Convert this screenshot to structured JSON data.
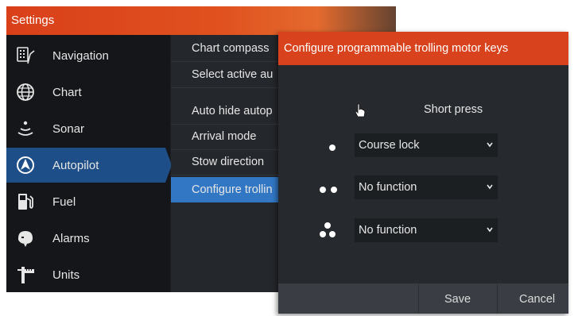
{
  "settings": {
    "title": "Settings",
    "nav": [
      {
        "icon": "navigation-icon",
        "label": "Navigation"
      },
      {
        "icon": "globe-icon",
        "label": "Chart"
      },
      {
        "icon": "sonar-icon",
        "label": "Sonar"
      },
      {
        "icon": "autopilot-icon",
        "label": "Autopilot",
        "active": true
      },
      {
        "icon": "fuel-icon",
        "label": "Fuel"
      },
      {
        "icon": "alarm-bell-icon",
        "label": "Alarms"
      },
      {
        "icon": "ruler-icon",
        "label": "Units"
      }
    ],
    "submenu": [
      {
        "label": "Chart compass"
      },
      {
        "label": "Select active au"
      },
      {
        "label": "Auto hide autop"
      },
      {
        "label": "Arrival mode"
      },
      {
        "label": "Stow direction"
      },
      {
        "label": "Configure trollin",
        "selected": true
      }
    ]
  },
  "dialog": {
    "title": "Configure programmable trolling motor keys",
    "column_header": "Short press",
    "rows": [
      {
        "key_icon": "one-dot-icon",
        "value": "Course lock"
      },
      {
        "key_icon": "two-dots-icon",
        "value": "No function"
      },
      {
        "key_icon": "three-dots-icon",
        "value": "No function"
      }
    ],
    "save_label": "Save",
    "cancel_label": "Cancel"
  },
  "colors": {
    "accent": "#d8421c",
    "selected": "#3277c4",
    "active_nav": "#1d4e87"
  }
}
